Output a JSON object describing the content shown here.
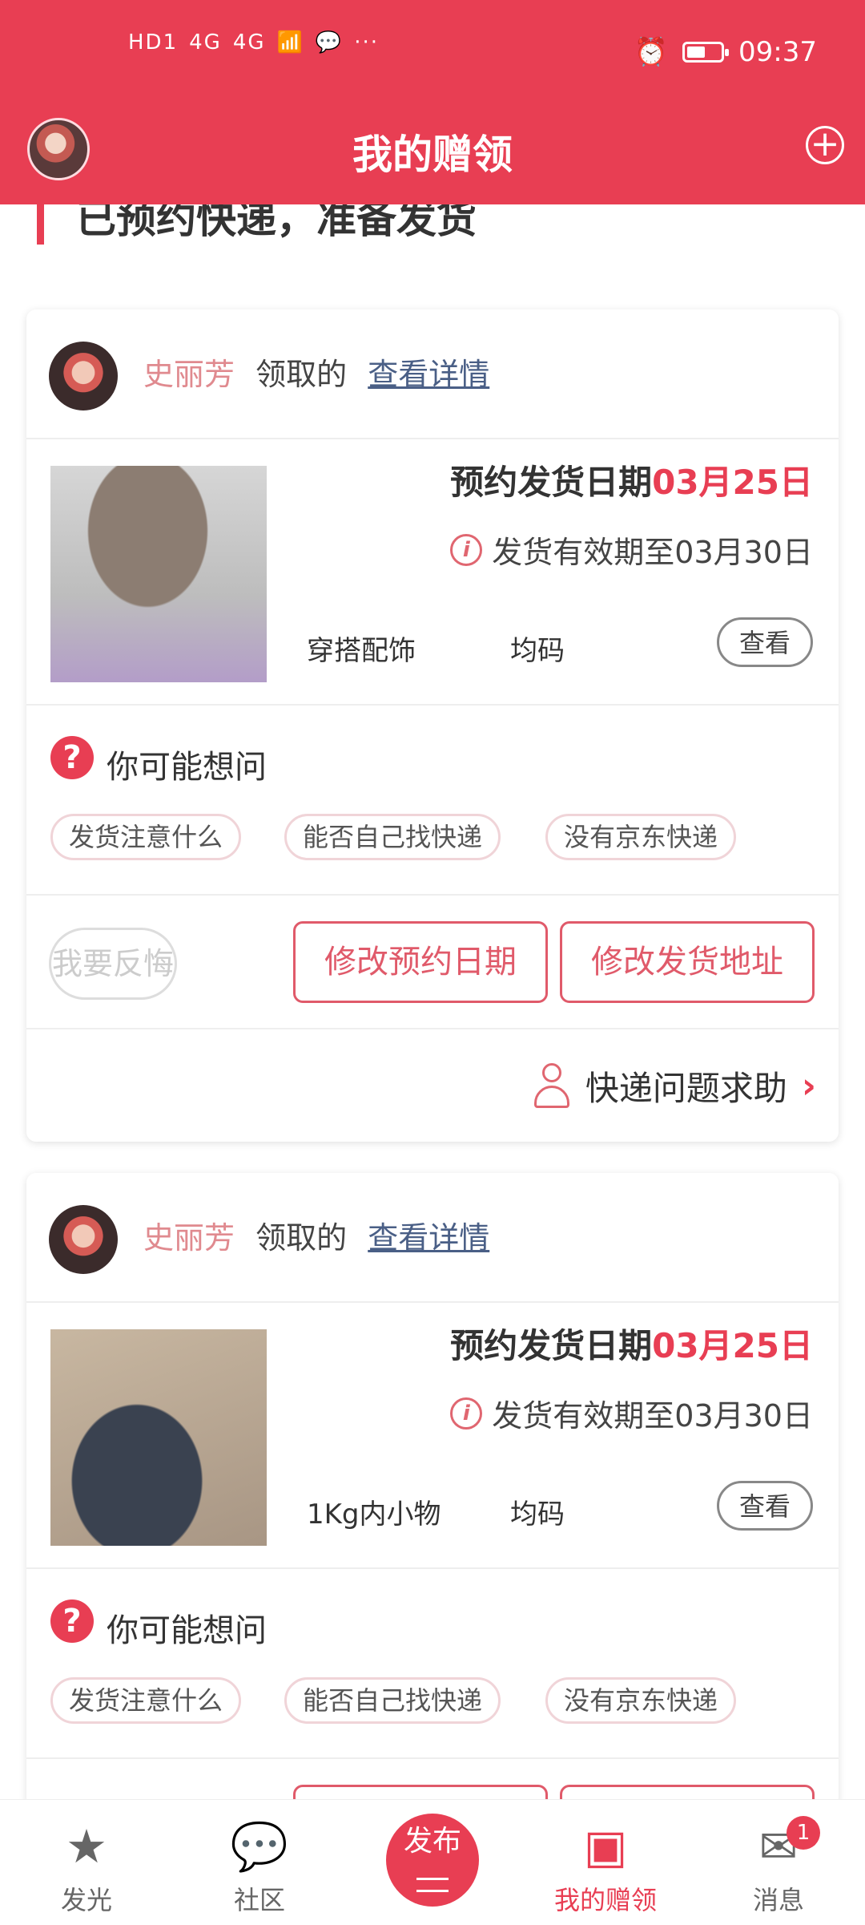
{
  "status_bar": {
    "network_labels": [
      "HD1",
      "4G",
      "4G"
    ],
    "time": "09:37",
    "battery_percent": 55
  },
  "header": {
    "title": "我的赠领"
  },
  "section": {
    "heading": "已预约快递，准备发货"
  },
  "cards": [
    {
      "user": "史丽芳",
      "verb": "领取的",
      "detail_link": "查看详情",
      "ship_date_label": "预约发货日期",
      "ship_date": "03月25日",
      "valid_text": "发货有效期至03月30日",
      "category": "穿搭配饰",
      "size": "均码",
      "view_label": "查看",
      "faq_title": "你可能想问",
      "faq_chips": [
        "发货注意什么",
        "能否自己找快递",
        "没有京东快递"
      ],
      "regret_label": "我要反悔",
      "change_date_label": "修改预约日期",
      "change_address_label": "修改发货地址",
      "help_label": "快递问题求助"
    },
    {
      "user": "史丽芳",
      "verb": "领取的",
      "detail_link": "查看详情",
      "ship_date_label": "预约发货日期",
      "ship_date": "03月25日",
      "valid_text": "发货有效期至03月30日",
      "category": "1Kg内小物",
      "size": "均码",
      "view_label": "查看",
      "faq_title": "你可能想问",
      "faq_chips": [
        "发货注意什么",
        "能否自己找快递",
        "没有京东快递"
      ]
    }
  ],
  "tabbar": {
    "items": [
      {
        "label": "发光",
        "icon": "star-icon"
      },
      {
        "label": "社区",
        "icon": "chat-bubble-icon"
      },
      {
        "label": "发布",
        "icon": "publish-icon"
      },
      {
        "label": "我的赠领",
        "icon": "gift-book-icon"
      },
      {
        "label": "消息",
        "icon": "mail-icon"
      }
    ],
    "message_badge": "1"
  },
  "colors": {
    "accent": "#e83e53"
  }
}
